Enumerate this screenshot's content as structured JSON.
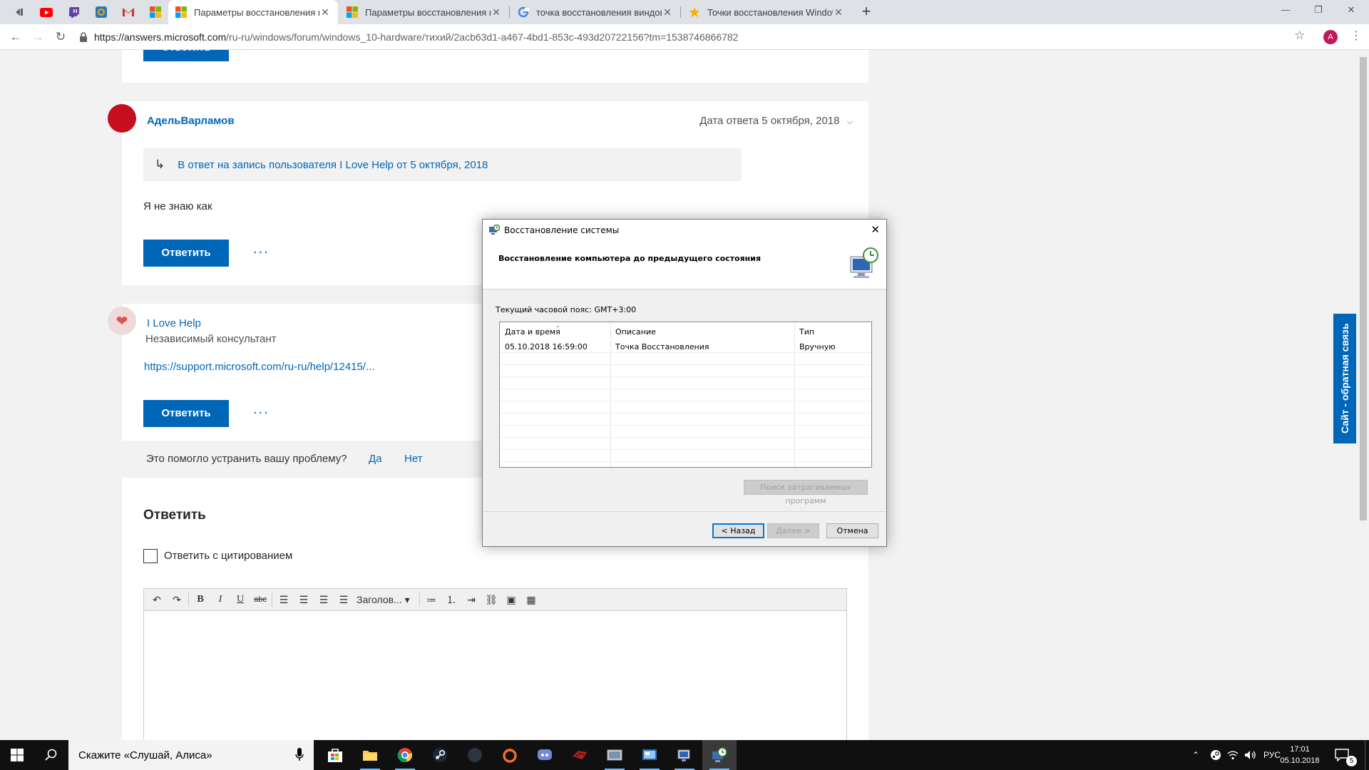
{
  "tabs": [
    {
      "title": "Параметры восстановления в W",
      "favicon": "microsoft-icon"
    },
    {
      "title": "Параметры восстановления в W",
      "favicon": "microsoft-icon"
    },
    {
      "title": "точка восстановления виндов",
      "favicon": "google-icon"
    },
    {
      "title": "Точки восстановления Window",
      "favicon": "star-icon"
    }
  ],
  "address": {
    "url_host": "https://answers.microsoft.com",
    "url_path": "/ru-ru/windows/forum/windows_10-hardware/тихий/2acb63d1-a467-4bd1-853c-493d20722156?tm=1538746866782"
  },
  "profile_initial": "A",
  "posts": {
    "reply_label": "Ответить",
    "more_label": "...",
    "post1": {
      "author": "АдельВарламов",
      "date": "Дата ответа 5 октября, 2018",
      "quote": "В ответ на запись пользователя I Love Help от 5 октября, 2018",
      "body": "Я не знаю как"
    },
    "post2": {
      "author": "I Love Help",
      "role": "Независимый консультант",
      "link": "https://support.microsoft.com/ru-ru/help/12415/..."
    },
    "helpful": {
      "question": "Это помогло устранить вашу проблему?",
      "yes": "Да",
      "no": "Нет"
    },
    "reply_section": {
      "title": "Ответить",
      "quote_checkbox": "Ответить с цитированием",
      "heading_select": "Заголов..."
    }
  },
  "feedback_tab": "Сайт - обратная связь",
  "dialog": {
    "title": "Восстановление системы",
    "heading": "Восстановление компьютера до предыдущего состояния",
    "timezone": "Текущий часовой пояс: GMT+3:00",
    "columns": [
      "Дата и время",
      "Описание",
      "Тип"
    ],
    "rows": [
      {
        "date": "05.10.2018 16:59:00",
        "description": "Точка Восстановления",
        "type": "Вручную"
      }
    ],
    "scan_button": "Поиск затрагиваемых программ",
    "back_button": "< Назад",
    "next_button": "Далее >",
    "cancel_button": "Отмена"
  },
  "taskbar": {
    "search_placeholder": "Скажите «Слушай, Алиса»",
    "language": "РУС",
    "time": "17:01",
    "date": "05.10.2018",
    "notification_count": "5"
  }
}
